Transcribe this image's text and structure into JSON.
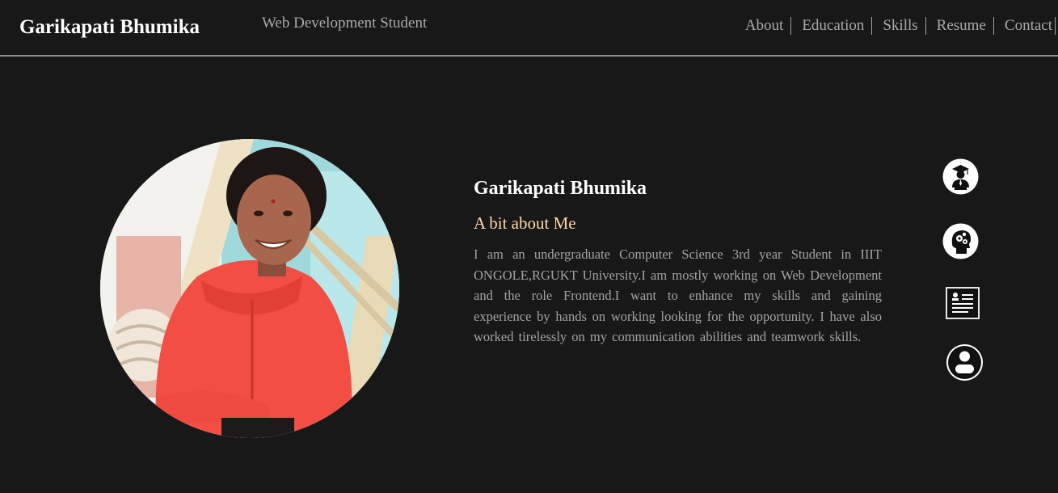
{
  "header": {
    "brand": "Garikapati Bhumika",
    "tagline": "Web Development Student",
    "nav": [
      {
        "label": "About"
      },
      {
        "label": "Education"
      },
      {
        "label": "Skills"
      },
      {
        "label": "Resume"
      },
      {
        "label": "Contact"
      }
    ]
  },
  "profile": {
    "photo_icon": "profile-photo",
    "name": "Garikapati Bhumika",
    "heading": "A bit about Me",
    "bio": "I am an undergraduate Computer Science 3rd year Student in IIIT ONGOLE,RGUKT University.I am mostly working on Web Development and the role Frontend.I want to enhance my skills and gaining experience by hands on working looking for the opportunity. I have also worked tirelessly on my communication abilities and teamwork skills."
  },
  "side_nav": [
    {
      "icon": "graduate-icon"
    },
    {
      "icon": "brain-gears-icon"
    },
    {
      "icon": "resume-icon"
    },
    {
      "icon": "user-icon"
    }
  ],
  "colors": {
    "background": "#181818",
    "brand_text": "#ffffff",
    "nav_text": "#a9a9a9",
    "accent_heading": "#ffd9a6",
    "body_text": "#a3a3a3",
    "header_rule": "#8a8a8a"
  }
}
